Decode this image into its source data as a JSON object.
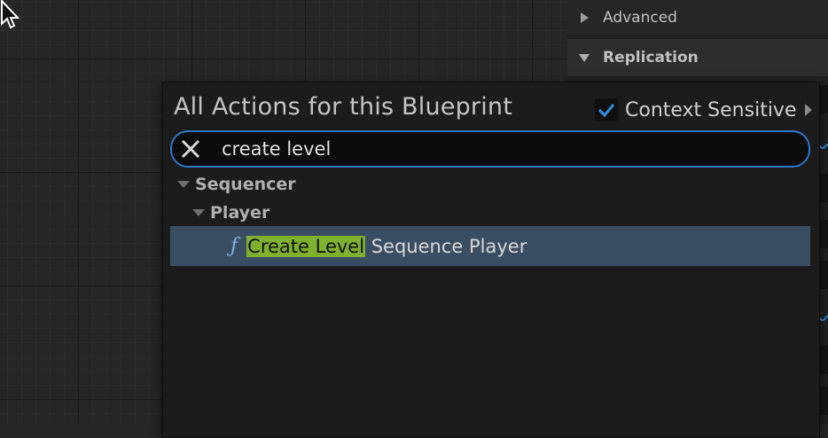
{
  "details_panel": {
    "advanced_label": "Advanced",
    "replication_label": "Replication"
  },
  "action_menu": {
    "title": "All Actions for this Blueprint",
    "context_sensitive": {
      "label": "Context Sensitive",
      "checked": true
    },
    "search": {
      "value": "create level",
      "icon": "close-icon"
    },
    "tree": {
      "category": "Sequencer",
      "subcategory": "Player",
      "result": {
        "icon": "function-icon",
        "icon_glyph": "ƒ",
        "highlight": "Create Level",
        "rest": " Sequence Player"
      }
    }
  },
  "colors": {
    "search_border": "#2b77c9",
    "selection_bg": "#3a4e63",
    "match_highlight": "#7fb12e",
    "check": "#2b8fe0"
  }
}
